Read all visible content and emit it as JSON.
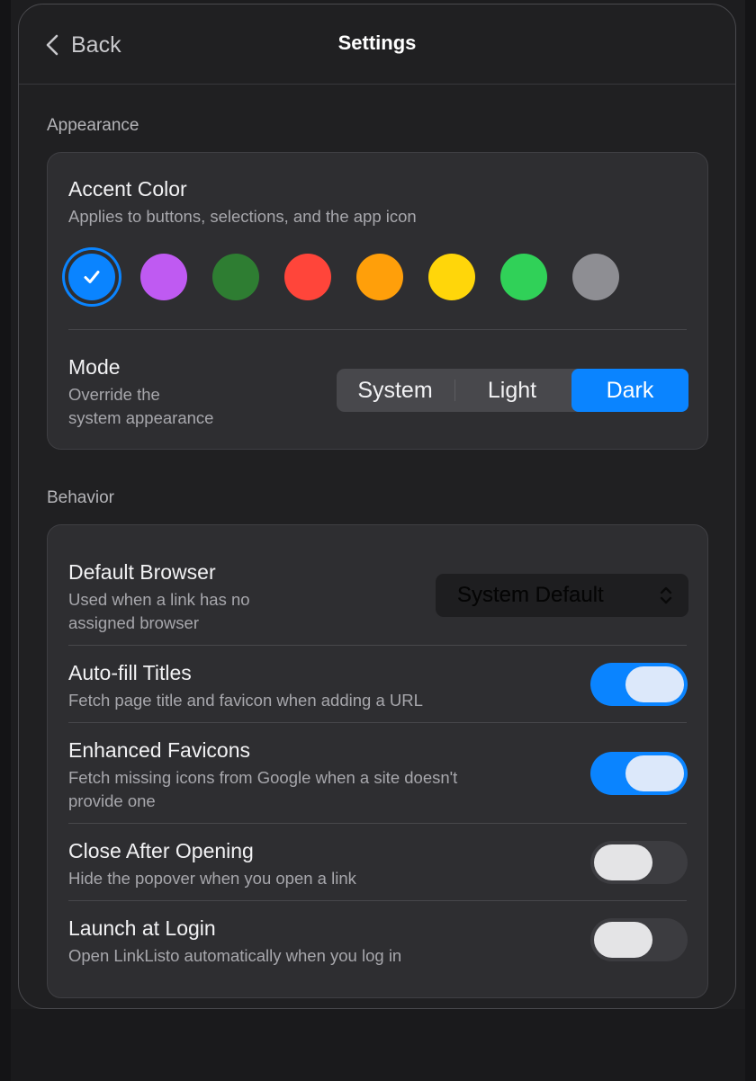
{
  "header": {
    "back_label": "Back",
    "title": "Settings"
  },
  "appearance": {
    "section_label": "Appearance",
    "accent": {
      "title": "Accent Color",
      "description": "Applies to buttons, selections, and the app icon",
      "selected_index": 0,
      "colors": [
        {
          "name": "blue",
          "hex": "#0a84ff"
        },
        {
          "name": "purple",
          "hex": "#bf5af2"
        },
        {
          "name": "dark-green",
          "hex": "#2e7d32"
        },
        {
          "name": "red",
          "hex": "#ff453a"
        },
        {
          "name": "orange",
          "hex": "#ff9f0a"
        },
        {
          "name": "yellow",
          "hex": "#ffd60a"
        },
        {
          "name": "green",
          "hex": "#30d158"
        },
        {
          "name": "gray",
          "hex": "#8e8e93"
        }
      ]
    },
    "mode": {
      "title": "Mode",
      "description_line1": "Override the",
      "description_line2": "system appearance",
      "options": [
        "System",
        "Light",
        "Dark"
      ],
      "selected": "Dark"
    }
  },
  "behavior": {
    "section_label": "Behavior",
    "default_browser": {
      "title": "Default Browser",
      "description_line1": "Used when a link has no",
      "description_line2": "assigned browser",
      "value": "System Default"
    },
    "autofill_titles": {
      "title": "Auto-fill Titles",
      "description": "Fetch page title and favicon when adding a URL",
      "enabled": true
    },
    "enhanced_favicons": {
      "title": "Enhanced Favicons",
      "description_line1": "Fetch missing icons from Google when a site doesn't",
      "description_line2": "provide one",
      "enabled": true
    },
    "close_after_opening": {
      "title": "Close After Opening",
      "description": "Hide the popover when you open a link",
      "enabled": false
    },
    "launch_at_login": {
      "title": "Launch at Login",
      "description": "Open LinkListo automatically when you log in",
      "enabled": false
    }
  },
  "colors": {
    "accent": "#0a84ff",
    "window_bg": "#202022",
    "card_bg": "#2e2e31"
  }
}
